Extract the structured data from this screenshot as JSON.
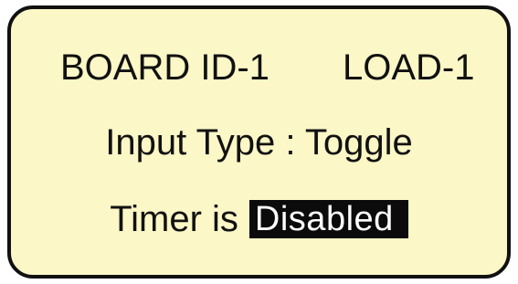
{
  "display": {
    "board_id": "BOARD ID-1",
    "load": "LOAD-1",
    "input_type_line": "Input Type : Toggle",
    "timer_label": "Timer is",
    "timer_status": "Disabled"
  },
  "colors": {
    "panel_background": "#fbf7c6",
    "panel_border": "#111111",
    "text": "#111111",
    "highlight_background": "#0b0b0b",
    "highlight_text": "#ffffff"
  }
}
